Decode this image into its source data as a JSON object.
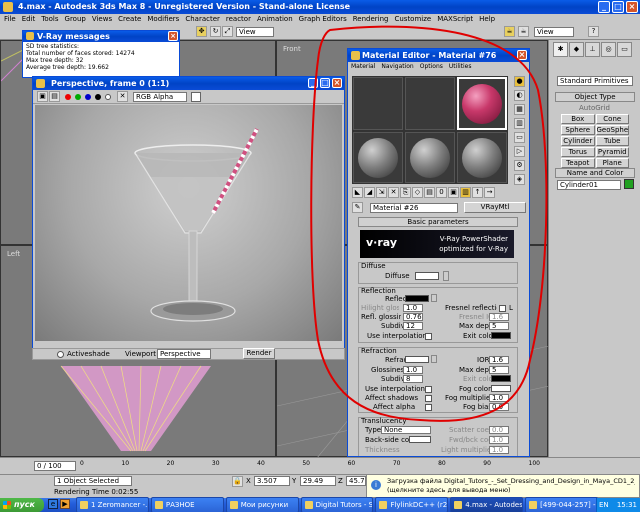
{
  "app": {
    "title": "4.max - Autodesk 3ds Max 8 - Unregistered Version - Stand-alone License",
    "menu": [
      "File",
      "Edit",
      "Tools",
      "Group",
      "Views",
      "Create",
      "Modifiers",
      "Character",
      "reactor",
      "Animation",
      "Graph Editors",
      "Rendering",
      "Customize",
      "MAXScript",
      "Help"
    ],
    "view_dropdown": "View",
    "viewport_labels": [
      "Front",
      "Left",
      "Perspective"
    ],
    "help_fragment": "?"
  },
  "vray_messages": {
    "title": "V-Ray messages",
    "lines": [
      "SD tree statistics:",
      "Total number of faces stored: 14274",
      "Max tree depth: 32",
      "Average tree depth: 19.662"
    ]
  },
  "frame_window": {
    "title": "Perspective, frame 0 (1:1)",
    "channel": "RGB Alpha",
    "activeshade_label": "Activeshade",
    "viewport_label": "Viewport",
    "viewport_value": "Perspective",
    "render_button": "Render"
  },
  "material_editor": {
    "title": "Material Editor - Material #76",
    "menu": [
      "Material",
      "Navigation",
      "Options",
      "Utilities"
    ],
    "material_name": "Material #26",
    "type_button": "VRayMtl",
    "basic_params": "Basic parameters",
    "vray_brand": "v·ray",
    "vray_tagline1": "V-Ray PowerShader",
    "vray_tagline2": "optimized for V-Ray",
    "diffuse": {
      "group": "Diffuse",
      "label": "Diffuse"
    },
    "reflection": {
      "group": "Reflection",
      "reflect": "Reflect",
      "hilight": "Hilight glossiness",
      "hilight_val": "1.0",
      "refl_gloss": "Refl. glossiness",
      "refl_gloss_val": "0.76",
      "subdivs": "Subdivs",
      "subdivs_val": "12",
      "use_interp": "Use interpolation",
      "fresnel": "Fresnel reflections",
      "fresnel_lock": "L",
      "fresnel_ior": "Fresnel IOR",
      "fresnel_ior_val": "1.6",
      "max_depth": "Max depth",
      "max_depth_val": "5",
      "exit_color": "Exit color"
    },
    "refraction": {
      "group": "Refraction",
      "refract": "Refract",
      "ior": "IOR",
      "ior_val": "1.6",
      "glossiness": "Glossiness",
      "glossiness_val": "1.0",
      "max_depth": "Max depth",
      "max_depth_val": "5",
      "subdivs": "Subdivs",
      "subdivs_val": "8",
      "exit_color": "Exit color",
      "use_interp": "Use interpolation",
      "fog_color": "Fog color",
      "affect_shadows": "Affect shadows",
      "fog_mult": "Fog multiplier",
      "fog_mult_val": "1.0",
      "affect_alpha": "Affect alpha",
      "fog_bias": "Fog bias",
      "fog_bias_val": "0.0"
    },
    "translucency": {
      "group": "Translucency",
      "type_label": "Type",
      "type_val": "None",
      "back_side": "Back-side color",
      "scatter_coeff": "Scatter coeff",
      "scatter_val": "0.0",
      "fwd_bck": "Fwd/bck coeff",
      "fwd_bck_val": "1.0",
      "thickness": "Thickness",
      "light_mult": "Light multiplier",
      "light_mult_val": "1.0"
    }
  },
  "command_panel": {
    "dropdown": "Standard Primitives",
    "object_type": "Object Type",
    "autogrid": "AutoGrid",
    "buttons": [
      "Box",
      "Cone",
      "Sphere",
      "GeoSphere",
      "Cylinder",
      "Tube",
      "Torus",
      "Pyramid",
      "Teapot",
      "Plane"
    ],
    "name_color": "Name and Color",
    "object_name": "Cylinder01"
  },
  "status": {
    "selection": "1 Object Selected",
    "render_time": "Rendering Time 0:02:55",
    "frame_counter": "0 / 100",
    "ruler": [
      "0",
      "10",
      "20",
      "30",
      "40",
      "50",
      "60",
      "70",
      "80",
      "90",
      "100"
    ],
    "x": "3.507",
    "y": "29.49",
    "z": "45.73",
    "x_label": "X",
    "y_label": "Y",
    "z_label": "Z"
  },
  "notification": {
    "line1": "Загрузка файла Digital_Tutors_-_Set_Dressing_and_Design_in_Maya_CD1_2_.part06.rar закончена",
    "line2": "(щелкните здесь для вывода меню)"
  },
  "taskbar": {
    "start": "пуск",
    "items": [
      "1 Zeromancer -...",
      "РАЗНОЕ",
      "Мои рисунки",
      "Digital Tutors - Se...",
      "FlylinkDC++ (r29...",
      "4.max - Autodesk...",
      "[499-044-257] - ..."
    ],
    "lang": "EN",
    "clock": "15:31"
  },
  "colors": {
    "taskbar": "#245edb",
    "start": "#3c9a35",
    "annotation": "#e00000",
    "selected_sphere": "#c8386a"
  }
}
